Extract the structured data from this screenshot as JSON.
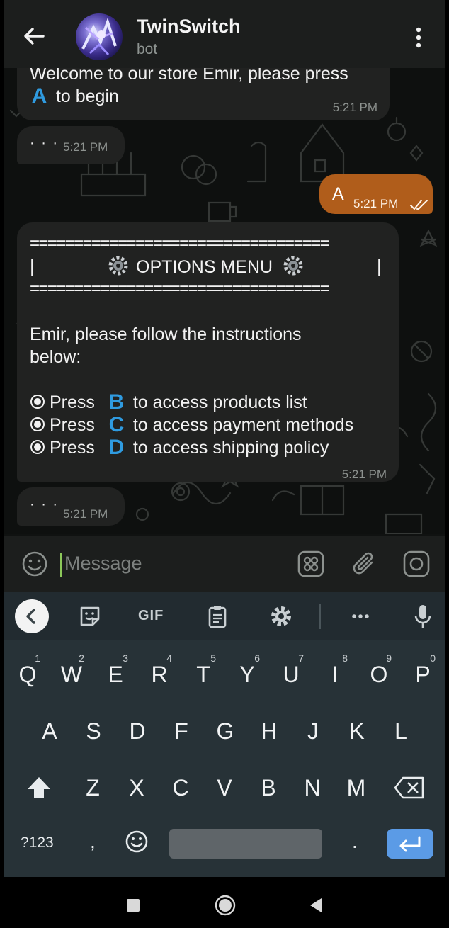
{
  "header": {
    "title": "TwinSwitch",
    "subtitle": "bot"
  },
  "messages": {
    "welcome": {
      "line1": "Welcome to our store Emir, please press",
      "key": "A",
      "line2": "to begin",
      "time": "5:21 PM"
    },
    "typing1": {
      "dots": "· · ·",
      "time": "5:21 PM"
    },
    "outgoing": {
      "text": "A",
      "time": "5:21 PM"
    },
    "menu": {
      "border": "==================================",
      "bar": "|",
      "heading": "OPTIONS MENU",
      "intro1": "Emir, please follow the instructions",
      "intro2": "below:",
      "items": [
        {
          "prefix": "Press",
          "key": "B",
          "text": "to access products list"
        },
        {
          "prefix": "Press",
          "key": "C",
          "text": "to access payment methods"
        },
        {
          "prefix": "Press",
          "key": "D",
          "text": "to access shipping policy"
        }
      ],
      "time": "5:21 PM"
    },
    "typing2": {
      "dots": "· · ·",
      "time": "5:21 PM"
    }
  },
  "input": {
    "placeholder": "Message"
  },
  "keyboard": {
    "toolbar": {
      "gif": "GIF"
    },
    "row1": [
      {
        "l": "Q",
        "n": "1"
      },
      {
        "l": "W",
        "n": "2"
      },
      {
        "l": "E",
        "n": "3"
      },
      {
        "l": "R",
        "n": "4"
      },
      {
        "l": "T",
        "n": "5"
      },
      {
        "l": "Y",
        "n": "6"
      },
      {
        "l": "U",
        "n": "7"
      },
      {
        "l": "I",
        "n": "8"
      },
      {
        "l": "O",
        "n": "9"
      },
      {
        "l": "P",
        "n": "0"
      }
    ],
    "row2": [
      "A",
      "S",
      "D",
      "F",
      "G",
      "H",
      "J",
      "K",
      "L"
    ],
    "row3": [
      "Z",
      "X",
      "C",
      "V",
      "B",
      "N",
      "M"
    ],
    "row4": {
      "symbols": "?123",
      "comma": ",",
      "period": "."
    }
  },
  "colors": {
    "header_bg": "#1c1e1d",
    "incoming_bubble": "#212221",
    "outgoing_bubble": "#b05d1b",
    "keycap_blue": "#2f9be0",
    "keyboard_bg": "#273237",
    "enter_key": "#5b9be6"
  },
  "icons": [
    "back-arrow-icon",
    "kebab-menu-icon",
    "smiley-icon",
    "bot-command-icon",
    "attach-icon",
    "camera-icon",
    "chevron-left-icon",
    "sticker-icon",
    "clipboard-icon",
    "gear-icon",
    "more-icon",
    "mic-icon",
    "shift-icon",
    "backspace-icon",
    "emoji-icon",
    "enter-icon",
    "nav-back-icon",
    "nav-home-icon",
    "nav-recents-icon",
    "read-check-icon"
  ]
}
